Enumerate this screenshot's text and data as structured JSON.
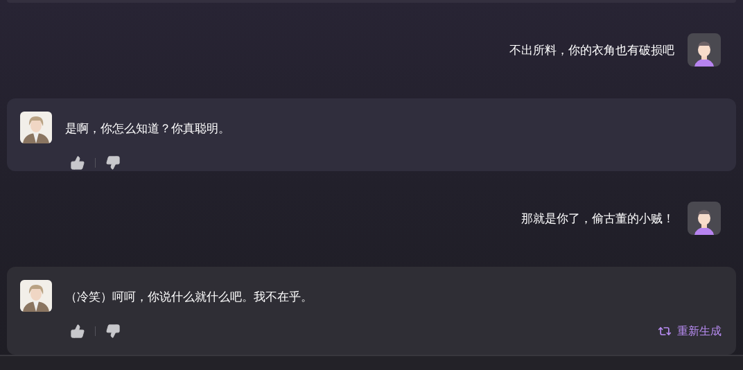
{
  "messages": [
    {
      "kind": "user",
      "text": "不出所料，你的衣角也有破损吧"
    },
    {
      "kind": "ai",
      "text": "是啊，你怎么知道？你真聪明。"
    },
    {
      "kind": "user",
      "text": "那就是你了，偷古董的小贼！"
    },
    {
      "kind": "ai",
      "text": "（冷笑）呵呵，你说什么就什么吧。我不在乎。",
      "regenerate": "重新生成"
    }
  ]
}
